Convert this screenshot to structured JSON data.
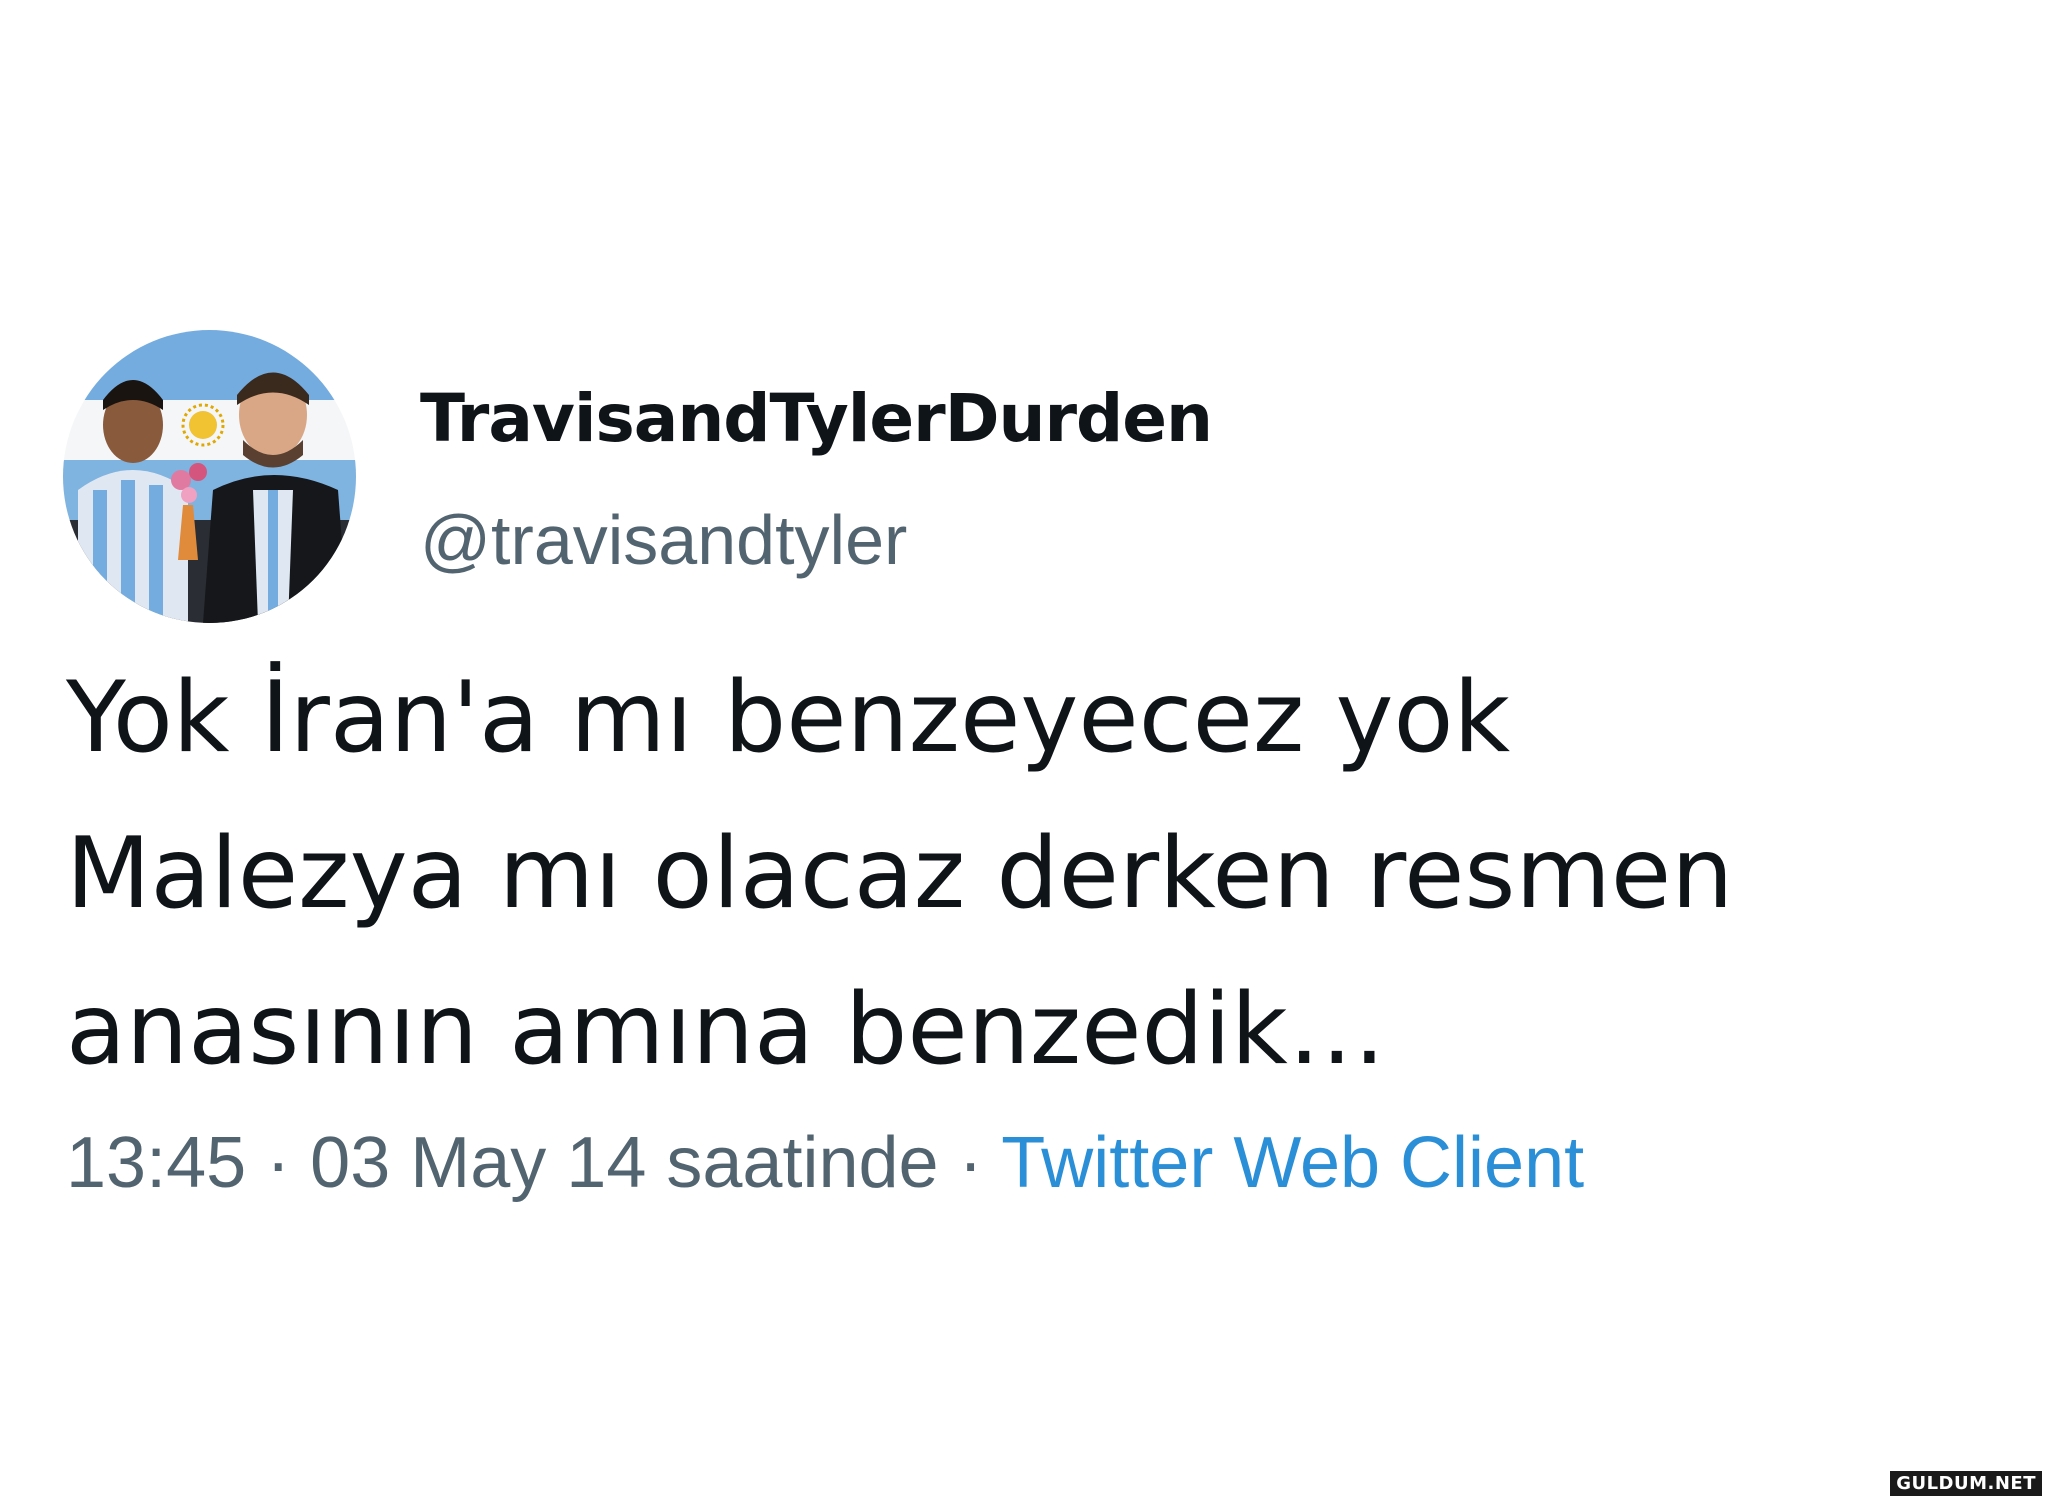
{
  "tweet": {
    "display_name": "TravisandTylerDurden",
    "handle": "@travisandtyler",
    "text_lines": [
      "Yok İran'a mı benzeyecez yok",
      "Malezya mı olacaz derken resmen",
      "anasının amına benzedik…"
    ],
    "time": "13:45",
    "separator": " · ",
    "date": "03 May 14 saatinde",
    "source": "Twitter Web Client"
  },
  "watermark": "GULDUM.NET",
  "colors": {
    "text_primary": "#0f1419",
    "text_secondary": "#536471",
    "link": "#2a8fd6",
    "flag_blue": "#74acdf"
  }
}
